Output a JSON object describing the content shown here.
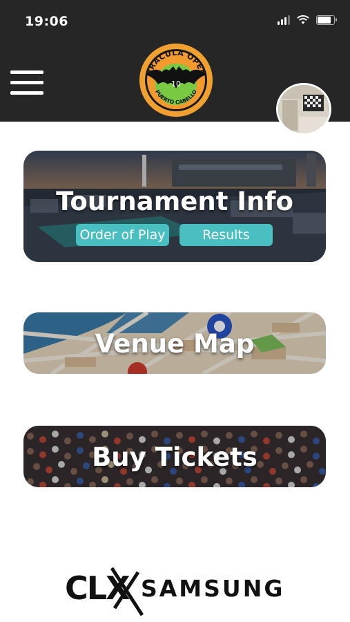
{
  "status_bar": {
    "time": "19:06"
  },
  "header": {
    "menu_icon": "hamburger-icon",
    "logo": {
      "name": "DRACULA OPEN",
      "city": "PUERTO CABELLO",
      "number": "10"
    },
    "avatar_icon": "profile-avatar"
  },
  "cards": {
    "tournament": {
      "title": "Tournament Info",
      "order_label": "Order of Play",
      "results_label": "Results"
    },
    "venue": {
      "title": "Venue Map"
    },
    "tickets": {
      "title": "Buy Tickets"
    }
  },
  "sponsor": {
    "clx": "CLX",
    "samsung": "SAMSUNG"
  },
  "colors": {
    "header_bg": "#262626",
    "accent_teal": "#49bfc1",
    "logo_orange": "#f0a030",
    "logo_green": "#7ac943"
  }
}
